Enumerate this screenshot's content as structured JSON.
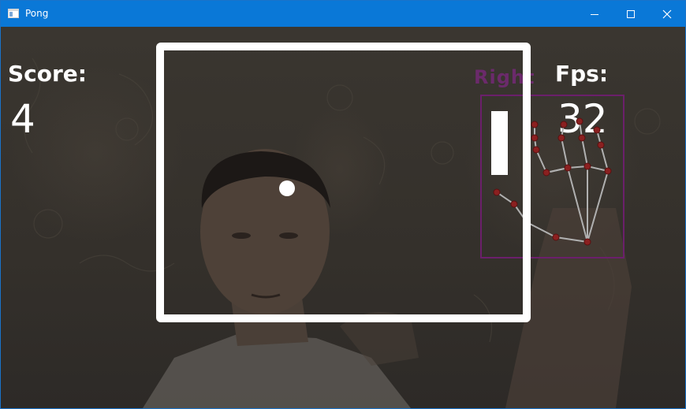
{
  "window": {
    "title": "Pong",
    "icons": {
      "app": "window-app-icon",
      "minimize": "minimize-icon",
      "maximize": "maximize-icon",
      "close": "close-icon"
    }
  },
  "game": {
    "score_label": "Score:",
    "score_value": "4",
    "fps_label": "Fps:",
    "fps_value": "32",
    "hand_label": "Right"
  },
  "colors": {
    "titlebar": "#0a78d7",
    "field_border": "#ffffff",
    "hand_box": "#6b1f6b",
    "landmark": "#8b2020",
    "skeleton": "#b0b0b0"
  }
}
